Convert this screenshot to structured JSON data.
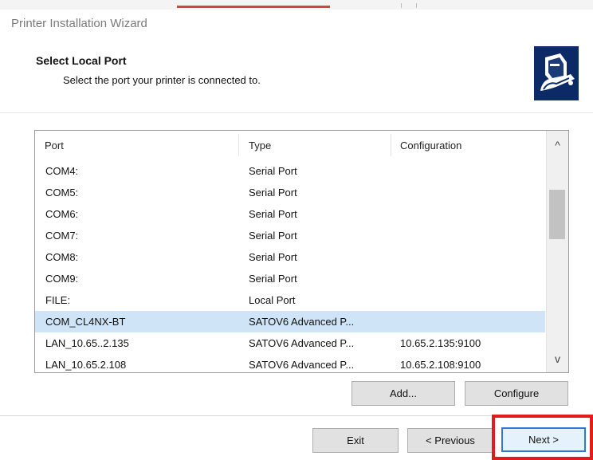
{
  "window": {
    "title": "Printer Installation Wizard"
  },
  "header": {
    "title": "Select Local Port",
    "subtitle": "Select the port your printer is connected to."
  },
  "icon": {
    "name": "printer-icon",
    "color": "#0b2a66"
  },
  "port_list": {
    "columns": [
      "Port",
      "Type",
      "Configuration"
    ],
    "rows": [
      {
        "port": "COM4:",
        "type": "Serial Port",
        "config": ""
      },
      {
        "port": "COM5:",
        "type": "Serial Port",
        "config": ""
      },
      {
        "port": "COM6:",
        "type": "Serial Port",
        "config": ""
      },
      {
        "port": "COM7:",
        "type": "Serial Port",
        "config": ""
      },
      {
        "port": "COM8:",
        "type": "Serial Port",
        "config": ""
      },
      {
        "port": "COM9:",
        "type": "Serial Port",
        "config": ""
      },
      {
        "port": "FILE:",
        "type": "Local Port",
        "config": ""
      },
      {
        "port": "COM_CL4NX-BT",
        "type": "SATOV6 Advanced P...",
        "config": ""
      },
      {
        "port": "LAN_10.65..2.135",
        "type": "SATOV6 Advanced P...",
        "config": "10.65.2.135:9100"
      },
      {
        "port": "LAN_10.65.2.108",
        "type": "SATOV6 Advanced P...",
        "config": "10.65.2.108:9100"
      }
    ],
    "selected_index": 7,
    "selected_color": "#cfe5f7",
    "scroll_up_glyph": "^",
    "scroll_down_glyph": "v"
  },
  "buttons": {
    "add": "Add...",
    "configure": "Configure",
    "exit": "Exit",
    "previous": "< Previous",
    "next": "Next >"
  },
  "highlight_color": "#e31b1b"
}
